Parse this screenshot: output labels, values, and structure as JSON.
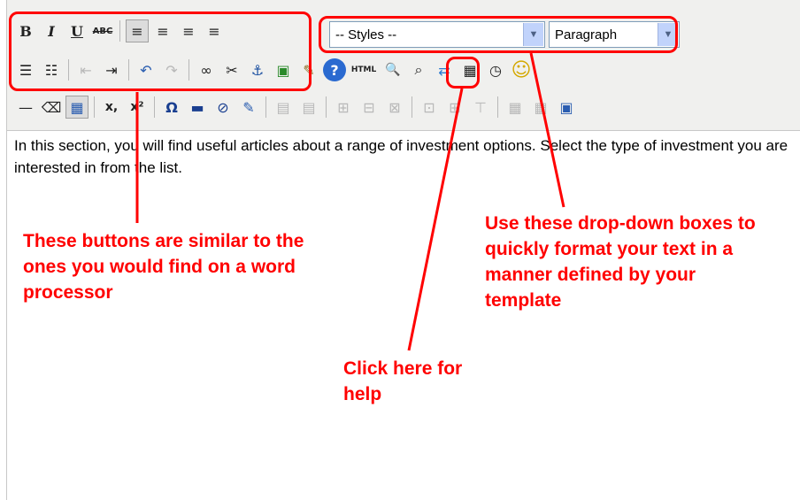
{
  "toolbar": {
    "row1": {
      "bold": "B",
      "italic": "I",
      "underline": "U",
      "strike": "ABC",
      "align_left": "≡",
      "align_center": "≡",
      "align_right": "≡",
      "justify": "≡"
    },
    "row2": {
      "bullets": "☰",
      "numbers": "☷",
      "outdent": "⇤",
      "indent": "⇥",
      "undo": "↶",
      "redo": "↷",
      "link": "∞",
      "unlink": "✂",
      "anchor": "⚓",
      "image": "▣",
      "cleanup": "✎",
      "help": "?",
      "html": "HTML",
      "find": "🔍",
      "findreplace": "⌕",
      "replace": "⇄",
      "date": "▦",
      "time": "◷",
      "emoticon": "☺"
    },
    "row3": {
      "hr": "—",
      "removeformat": "⌫",
      "table": "▦",
      "sub": "x,",
      "sup": "x²",
      "charmap": "Ω",
      "hrule": "▬",
      "flash": "⊘",
      "edit": "✎",
      "t1": "▤",
      "t2": "▤",
      "t3": "⊞",
      "t4": "⊟",
      "t5": "⊠",
      "t6": "⊡",
      "t7": "⊞",
      "t8": "⊤",
      "t9": "▦",
      "t10": "▦",
      "t11": "▣"
    },
    "styles_value": "-- Styles --",
    "format_value": "Paragraph"
  },
  "content": {
    "text": "In this section, you will find useful articles about a range of investment options. Select the type of investment you are interested in from the list."
  },
  "annotations": {
    "buttons_note": "These buttons are similar to the ones you would find on a word processor",
    "help_note": "Click here for help",
    "dropdown_note": "Use these drop-down boxes to quickly format your text in a manner defined by your template"
  },
  "colors": {
    "annotation": "#ff0000",
    "toolbar_bg": "#f0f0ee"
  }
}
